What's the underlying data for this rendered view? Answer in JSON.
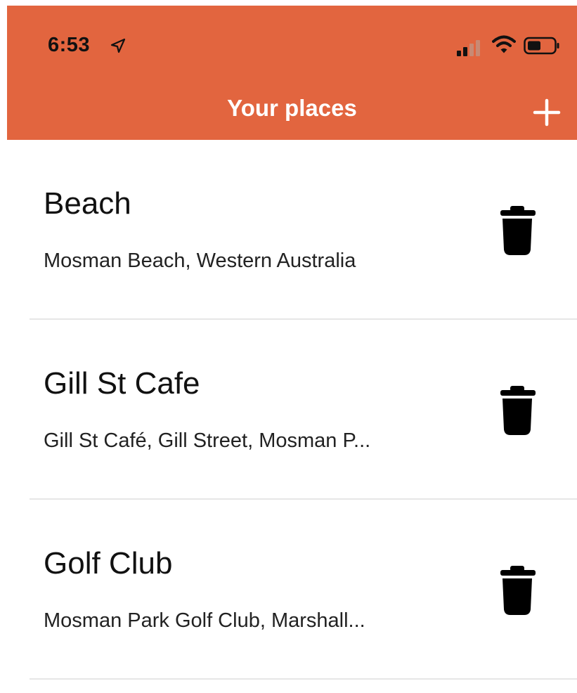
{
  "status_bar": {
    "time": "6:53"
  },
  "header": {
    "title": "Your places",
    "background_color": "#E2653F",
    "add_icon": "plus-icon"
  },
  "places": [
    {
      "title": "Beach",
      "address": "Mosman Beach, Western Australia"
    },
    {
      "title": "Gill St Cafe",
      "address": "Gill St Café, Gill Street, Mosman P..."
    },
    {
      "title": "Golf Club",
      "address": "Mosman Park Golf Club, Marshall..."
    }
  ],
  "row_action_icon": "trash-icon"
}
